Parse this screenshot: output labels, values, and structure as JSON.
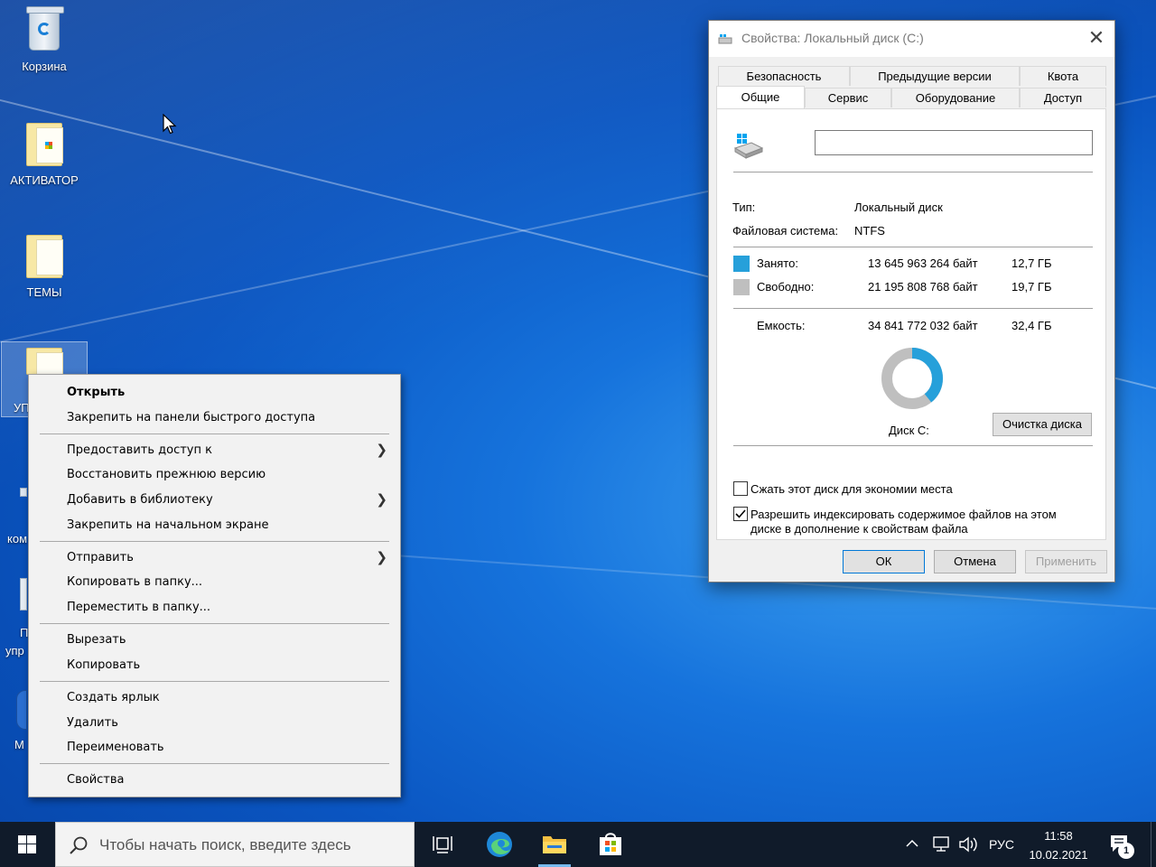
{
  "desktop": {
    "icons": [
      {
        "label": "Корзина"
      },
      {
        "label": "АКТИВАТОР"
      },
      {
        "label": "ТЕМЫ"
      }
    ],
    "partial_labels": [
      "УП",
      "ком",
      "П",
      "упр",
      "М"
    ]
  },
  "context_menu": {
    "groups": [
      [
        "Открыть",
        "Закрепить на панели быстрого доступа"
      ],
      [
        "Предоставить доступ к",
        "Восстановить прежнюю версию",
        "Добавить в библиотеку",
        "Закрепить на начальном экране"
      ],
      [
        "Отправить",
        "Копировать в папку...",
        "Переместить в папку..."
      ],
      [
        "Вырезать",
        "Копировать"
      ],
      [
        "Создать ярлык",
        "Удалить",
        "Переименовать"
      ],
      [
        "Свойства"
      ]
    ],
    "items_with_submenu": [
      "Предоставить доступ к",
      "Добавить в библиотеку",
      "Отправить"
    ],
    "default_item": "Открыть"
  },
  "dialog": {
    "title": "Свойства: Локальный диск (C:)",
    "tabs_top": [
      "Безопасность",
      "Предыдущие версии",
      "Квота"
    ],
    "tabs_bottom": [
      "Общие",
      "Сервис",
      "Оборудование",
      "Доступ"
    ],
    "active_tab": "Общие",
    "name_value": "",
    "type_label": "Тип:",
    "type_value": "Локальный диск",
    "fs_label": "Файловая система:",
    "fs_value": "NTFS",
    "used_label": "Занято:",
    "used_bytes": "13 645 963 264 байт",
    "used_gb": "12,7 ГБ",
    "free_label": "Свободно:",
    "free_bytes": "21 195 808 768 байт",
    "free_gb": "19,7 ГБ",
    "capacity_label": "Емкость:",
    "capacity_bytes": "34 841 772 032 байт",
    "capacity_gb": "32,4 ГБ",
    "disk_label": "Диск C:",
    "cleanup_button": "Очистка диска",
    "compress_label": "Сжать этот диск для экономии места",
    "compress_checked": false,
    "index_label_line1": "Разрешить индексировать содержимое файлов на этом",
    "index_label_line2": "диске в дополнение к свойствам файла",
    "index_checked": true,
    "ok_button": "ОК",
    "cancel_button": "Отмена",
    "apply_button": "Применить",
    "used_fraction": 0.392,
    "colors": {
      "used": "#26a0da",
      "free": "#bfbfbf"
    }
  },
  "taskbar": {
    "search_placeholder": "Чтобы начать поиск, введите здесь",
    "language": "РУС",
    "time": "11:58",
    "date": "10.02.2021",
    "notification_count": "1"
  }
}
